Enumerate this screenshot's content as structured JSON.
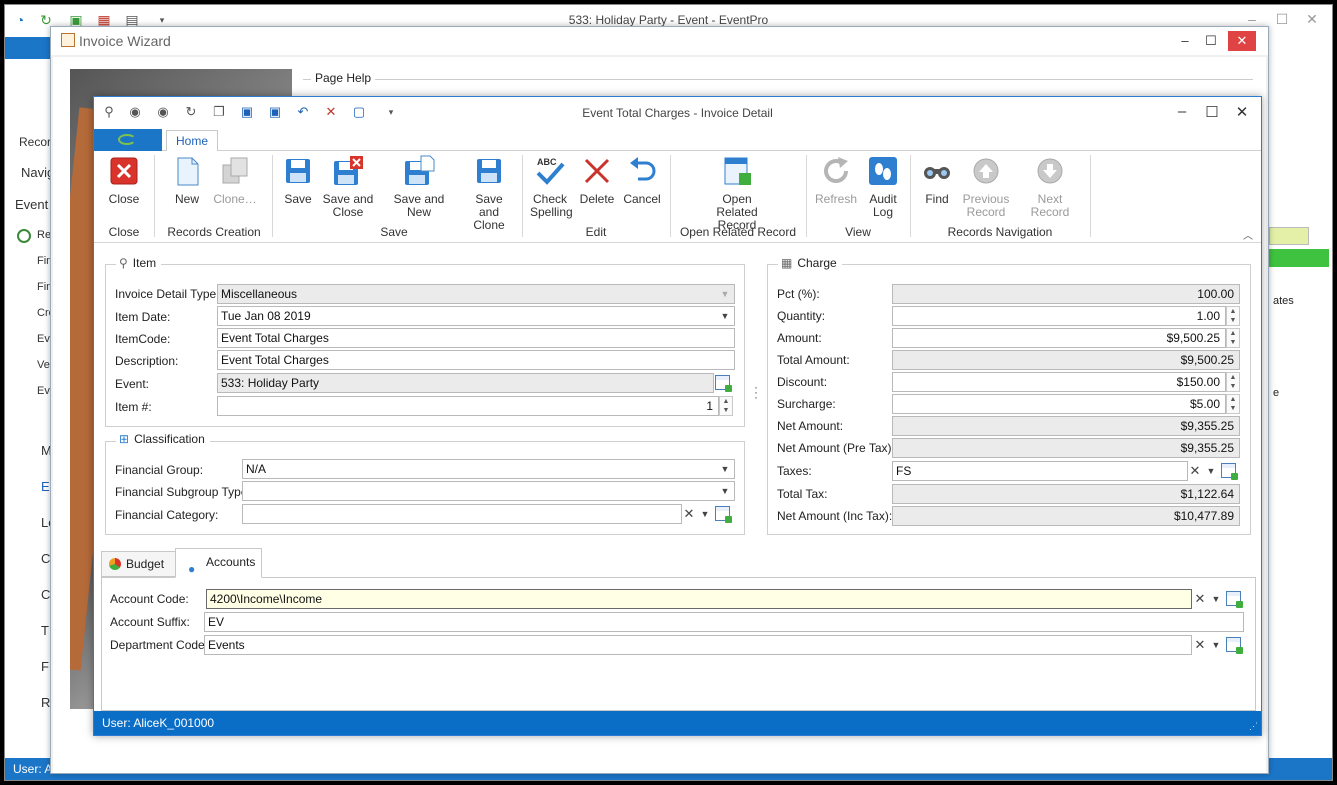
{
  "main_window": {
    "title": "533: Holiday Party - Event - EventPro",
    "left_labels": [
      "Recor",
      "Navig",
      "Event",
      "Re",
      "Fin",
      "Fin",
      "Cre",
      "Ev",
      "Ve",
      "Ev",
      "M",
      "E",
      "Lo",
      "C",
      "C",
      "T",
      "F",
      "R"
    ],
    "status": "User: Al",
    "right_text": "ates",
    "right_text2": "e"
  },
  "wizard": {
    "title": "Invoice Wizard",
    "page_help_label": "Page Help"
  },
  "dialog": {
    "title": "Event Total Charges - Invoice Detail",
    "home_tab": "Home",
    "status_user": "User: AliceK_001000"
  },
  "ribbon": {
    "buttons": {
      "close": "Close",
      "new": "New",
      "clone": "Clone…",
      "save": "Save",
      "save_close_1": "Save and",
      "save_close_2": "Close",
      "save_new": "Save and New",
      "save_clone_1": "Save and",
      "save_clone_2": "Clone",
      "check_spelling_1": "Check",
      "check_spelling_2": "Spelling",
      "delete": "Delete",
      "cancel": "Cancel",
      "open_related_1": "Open Related",
      "open_related_2": "Record",
      "refresh": "Refresh",
      "audit_log_1": "Audit",
      "audit_log_2": "Log",
      "find": "Find",
      "previous_record_1": "Previous",
      "previous_record_2": "Record",
      "next_record": "Next Record"
    },
    "groups": {
      "close": "Close",
      "records_creation": "Records Creation",
      "save": "Save",
      "edit": "Edit",
      "open_related_record": "Open Related Record",
      "view": "View",
      "records_navigation": "Records Navigation"
    }
  },
  "item": {
    "title": "Item",
    "invoice_detail_type_label": "Invoice Detail Type:",
    "invoice_detail_type": "Miscellaneous",
    "item_date_label": "Item Date:",
    "item_date": "Tue Jan 08 2019",
    "item_code_label": "ItemCode:",
    "item_code": "Event Total Charges",
    "description_label": "Description:",
    "description": "Event Total Charges",
    "event_label": "Event:",
    "event": "533: Holiday Party",
    "item_no_label": "Item #:",
    "item_no": "1"
  },
  "classification": {
    "title": "Classification",
    "financial_group_label": "Financial Group:",
    "financial_group": "N/A",
    "financial_subgroup_type_label": "Financial Subgroup Type:",
    "financial_subgroup_type": "",
    "financial_category_label": "Financial Category:",
    "financial_category": ""
  },
  "charge": {
    "title": "Charge",
    "pct_label": "Pct (%):",
    "pct": "100.00",
    "quantity_label": "Quantity:",
    "quantity": "1.00",
    "amount_label": "Amount:",
    "amount": "$9,500.25",
    "total_amount_label": "Total Amount:",
    "total_amount": "$9,500.25",
    "discount_label": "Discount:",
    "discount": "$150.00",
    "surcharge_label": "Surcharge:",
    "surcharge": "$5.00",
    "net_amount_label": "Net Amount:",
    "net_amount": "$9,355.25",
    "net_amount_pre_tax_label": "Net Amount (Pre Tax):",
    "net_amount_pre_tax": "$9,355.25",
    "taxes_label": "Taxes:",
    "taxes": "FS",
    "total_tax_label": "Total Tax:",
    "total_tax": "$1,122.64",
    "net_amount_inc_tax_label": "Net Amount (Inc Tax):",
    "net_amount_inc_tax": "$10,477.89"
  },
  "tabs": {
    "budget": "Budget",
    "accounts": "Accounts"
  },
  "accounts": {
    "account_code_label": "Account Code:",
    "account_code": "4200\\Income\\Income",
    "account_suffix_label": "Account Suffix:",
    "account_suffix": "EV",
    "department_code_label": "Department Code:",
    "department_code": "Events"
  },
  "colors": {
    "accent_blue": "#1c76c8",
    "status_blue": "#0a6dc6",
    "close_red": "#e04343"
  }
}
